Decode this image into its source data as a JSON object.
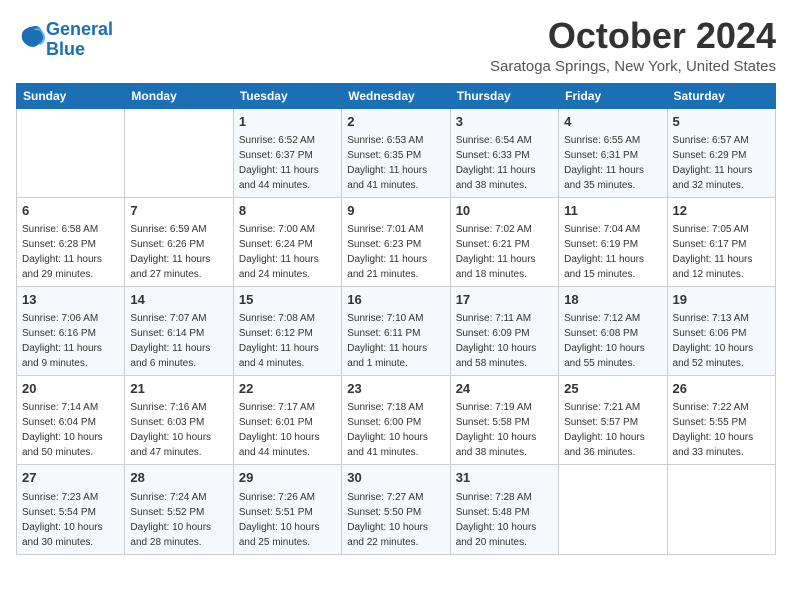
{
  "logo": {
    "line1": "General",
    "line2": "Blue"
  },
  "title": "October 2024",
  "location": "Saratoga Springs, New York, United States",
  "headers": [
    "Sunday",
    "Monday",
    "Tuesday",
    "Wednesday",
    "Thursday",
    "Friday",
    "Saturday"
  ],
  "weeks": [
    [
      {
        "day": "",
        "info": ""
      },
      {
        "day": "",
        "info": ""
      },
      {
        "day": "1",
        "info": "Sunrise: 6:52 AM\nSunset: 6:37 PM\nDaylight: 11 hours and 44 minutes."
      },
      {
        "day": "2",
        "info": "Sunrise: 6:53 AM\nSunset: 6:35 PM\nDaylight: 11 hours and 41 minutes."
      },
      {
        "day": "3",
        "info": "Sunrise: 6:54 AM\nSunset: 6:33 PM\nDaylight: 11 hours and 38 minutes."
      },
      {
        "day": "4",
        "info": "Sunrise: 6:55 AM\nSunset: 6:31 PM\nDaylight: 11 hours and 35 minutes."
      },
      {
        "day": "5",
        "info": "Sunrise: 6:57 AM\nSunset: 6:29 PM\nDaylight: 11 hours and 32 minutes."
      }
    ],
    [
      {
        "day": "6",
        "info": "Sunrise: 6:58 AM\nSunset: 6:28 PM\nDaylight: 11 hours and 29 minutes."
      },
      {
        "day": "7",
        "info": "Sunrise: 6:59 AM\nSunset: 6:26 PM\nDaylight: 11 hours and 27 minutes."
      },
      {
        "day": "8",
        "info": "Sunrise: 7:00 AM\nSunset: 6:24 PM\nDaylight: 11 hours and 24 minutes."
      },
      {
        "day": "9",
        "info": "Sunrise: 7:01 AM\nSunset: 6:23 PM\nDaylight: 11 hours and 21 minutes."
      },
      {
        "day": "10",
        "info": "Sunrise: 7:02 AM\nSunset: 6:21 PM\nDaylight: 11 hours and 18 minutes."
      },
      {
        "day": "11",
        "info": "Sunrise: 7:04 AM\nSunset: 6:19 PM\nDaylight: 11 hours and 15 minutes."
      },
      {
        "day": "12",
        "info": "Sunrise: 7:05 AM\nSunset: 6:17 PM\nDaylight: 11 hours and 12 minutes."
      }
    ],
    [
      {
        "day": "13",
        "info": "Sunrise: 7:06 AM\nSunset: 6:16 PM\nDaylight: 11 hours and 9 minutes."
      },
      {
        "day": "14",
        "info": "Sunrise: 7:07 AM\nSunset: 6:14 PM\nDaylight: 11 hours and 6 minutes."
      },
      {
        "day": "15",
        "info": "Sunrise: 7:08 AM\nSunset: 6:12 PM\nDaylight: 11 hours and 4 minutes."
      },
      {
        "day": "16",
        "info": "Sunrise: 7:10 AM\nSunset: 6:11 PM\nDaylight: 11 hours and 1 minute."
      },
      {
        "day": "17",
        "info": "Sunrise: 7:11 AM\nSunset: 6:09 PM\nDaylight: 10 hours and 58 minutes."
      },
      {
        "day": "18",
        "info": "Sunrise: 7:12 AM\nSunset: 6:08 PM\nDaylight: 10 hours and 55 minutes."
      },
      {
        "day": "19",
        "info": "Sunrise: 7:13 AM\nSunset: 6:06 PM\nDaylight: 10 hours and 52 minutes."
      }
    ],
    [
      {
        "day": "20",
        "info": "Sunrise: 7:14 AM\nSunset: 6:04 PM\nDaylight: 10 hours and 50 minutes."
      },
      {
        "day": "21",
        "info": "Sunrise: 7:16 AM\nSunset: 6:03 PM\nDaylight: 10 hours and 47 minutes."
      },
      {
        "day": "22",
        "info": "Sunrise: 7:17 AM\nSunset: 6:01 PM\nDaylight: 10 hours and 44 minutes."
      },
      {
        "day": "23",
        "info": "Sunrise: 7:18 AM\nSunset: 6:00 PM\nDaylight: 10 hours and 41 minutes."
      },
      {
        "day": "24",
        "info": "Sunrise: 7:19 AM\nSunset: 5:58 PM\nDaylight: 10 hours and 38 minutes."
      },
      {
        "day": "25",
        "info": "Sunrise: 7:21 AM\nSunset: 5:57 PM\nDaylight: 10 hours and 36 minutes."
      },
      {
        "day": "26",
        "info": "Sunrise: 7:22 AM\nSunset: 5:55 PM\nDaylight: 10 hours and 33 minutes."
      }
    ],
    [
      {
        "day": "27",
        "info": "Sunrise: 7:23 AM\nSunset: 5:54 PM\nDaylight: 10 hours and 30 minutes."
      },
      {
        "day": "28",
        "info": "Sunrise: 7:24 AM\nSunset: 5:52 PM\nDaylight: 10 hours and 28 minutes."
      },
      {
        "day": "29",
        "info": "Sunrise: 7:26 AM\nSunset: 5:51 PM\nDaylight: 10 hours and 25 minutes."
      },
      {
        "day": "30",
        "info": "Sunrise: 7:27 AM\nSunset: 5:50 PM\nDaylight: 10 hours and 22 minutes."
      },
      {
        "day": "31",
        "info": "Sunrise: 7:28 AM\nSunset: 5:48 PM\nDaylight: 10 hours and 20 minutes."
      },
      {
        "day": "",
        "info": ""
      },
      {
        "day": "",
        "info": ""
      }
    ]
  ]
}
